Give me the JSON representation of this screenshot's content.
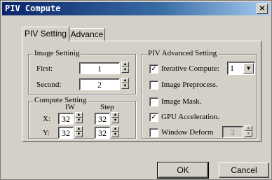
{
  "window": {
    "title": "PIV Compute",
    "close_symbol": "×"
  },
  "tabs": [
    {
      "label": "PIV Setting",
      "active": true
    },
    {
      "label": "Advance",
      "active": false
    }
  ],
  "image_setting": {
    "title": "Image Settinig",
    "first_label": "First:",
    "first_value": "1",
    "second_label": "Second:",
    "second_value": "2"
  },
  "compute_setting": {
    "title": "Compute Setting",
    "iw_header": "IW",
    "step_header": "Step",
    "x_label": "X:",
    "y_label": "Y:",
    "iw_x": "32",
    "iw_y": "32",
    "step_x": "32",
    "step_y": "32"
  },
  "advanced": {
    "title": "PIV Advanced Setting",
    "iterative_label": "Iterative Compute:",
    "iterative_checked": true,
    "iterative_value": "1",
    "preprocess_label": "Image Preprocess.",
    "preprocess_checked": false,
    "mask_label": "Image Mask.",
    "mask_checked": false,
    "gpu_label": "GPU Acceleration.",
    "gpu_checked": true,
    "window_deform_label": "Window Deform",
    "window_deform_checked": false,
    "window_deform_value": "2"
  },
  "buttons": {
    "ok": "OK",
    "cancel": "Cancel"
  },
  "icons": {
    "check": "✓",
    "up": "▲",
    "down": "▼"
  }
}
